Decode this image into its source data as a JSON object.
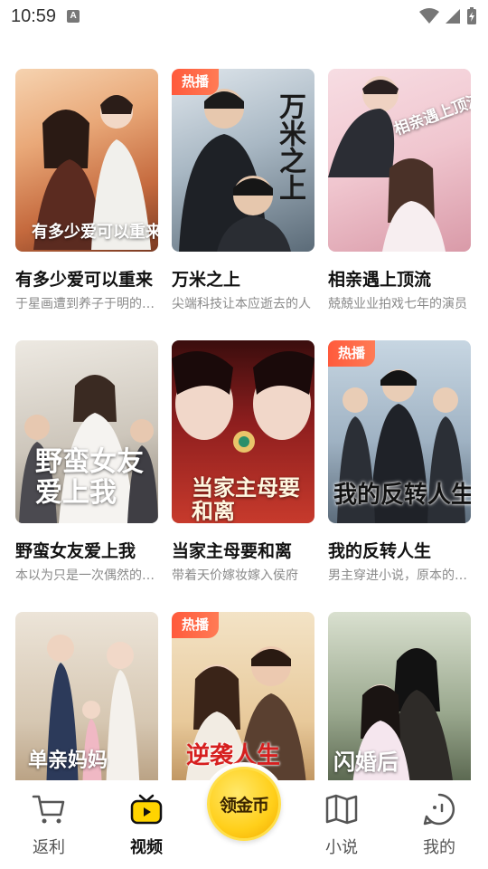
{
  "status_bar": {
    "time": "10:59",
    "notification_letter": "A"
  },
  "dramas": [
    {
      "title": "有多少爱可以重来",
      "desc": "于星画遭到养子于明的陷害",
      "badge": "",
      "poster_text": "有多少爱可以重来"
    },
    {
      "title": "万米之上",
      "desc": "尖端科技让本应逝去的人",
      "badge": "热播",
      "poster_text": "万米之上"
    },
    {
      "title": "相亲遇上顶流",
      "desc": "兢兢业业拍戏七年的演员",
      "badge": "",
      "poster_text": "相亲遇上顶流"
    },
    {
      "title": "野蛮女友爱上我",
      "desc": "本以为只是一次偶然的相遇",
      "badge": "",
      "poster_text": "野蛮女友爱上我"
    },
    {
      "title": "当家主母要和离",
      "desc": "带着天价嫁妆嫁入侯府",
      "badge": "",
      "poster_text": "当家主母要和离"
    },
    {
      "title": "我的反转人生",
      "desc": "男主穿进小说，原本的人生",
      "badge": "热播",
      "poster_text": "我的反转人生"
    },
    {
      "title": "",
      "desc": "",
      "badge": "",
      "poster_text": "单亲妈妈"
    },
    {
      "title": "",
      "desc": "",
      "badge": "热播",
      "poster_text": "逆袭人生"
    },
    {
      "title": "",
      "desc": "",
      "badge": "",
      "poster_text": "闪婚后"
    }
  ],
  "bottom_nav": {
    "items": [
      {
        "label": "返利",
        "icon": "cart-icon",
        "active": false
      },
      {
        "label": "视频",
        "icon": "tv-icon",
        "active": true
      },
      {
        "label": "小说",
        "icon": "book-icon",
        "active": false
      },
      {
        "label": "我的",
        "icon": "profile-face-icon",
        "active": false
      }
    ],
    "center_coin_label": "领金币"
  },
  "colors": {
    "badge": "#ff5a3c",
    "coin": "#ffcf1a",
    "accent_active": "#ffd400"
  }
}
